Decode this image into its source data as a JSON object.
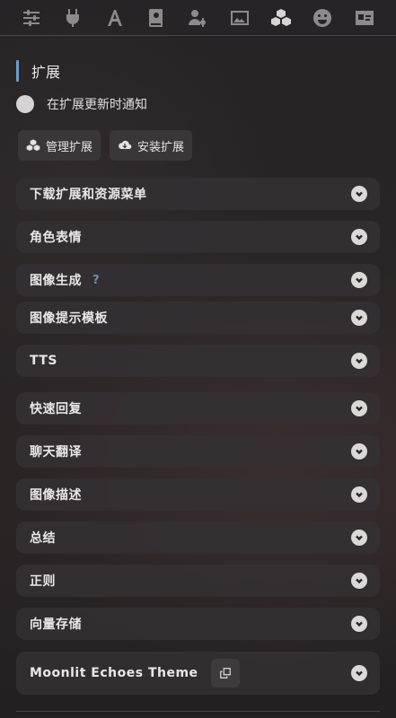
{
  "topbar": {
    "icons": [
      {
        "name": "sliders-icon"
      },
      {
        "name": "plug-icon"
      },
      {
        "name": "font-icon"
      },
      {
        "name": "book-icon"
      },
      {
        "name": "user-gear-icon"
      },
      {
        "name": "image-icon"
      },
      {
        "name": "cubes-icon",
        "active": true
      },
      {
        "name": "smile-icon"
      },
      {
        "name": "id-card-icon"
      }
    ]
  },
  "section": {
    "title": "扩展"
  },
  "notify": {
    "label": "在扩展更新时通知",
    "enabled": false
  },
  "buttons": {
    "manage": "管理扩展",
    "install": "安装扩展"
  },
  "drawers": [
    {
      "label": "下载扩展和资源菜单"
    },
    {
      "label": "角色表情"
    },
    {
      "label": "图像生成",
      "help": "?"
    },
    {
      "label": "图像提示模板"
    },
    {
      "label": "TTS"
    },
    {
      "label": "快速回复"
    },
    {
      "label": "聊天翻译"
    },
    {
      "label": "图像描述"
    },
    {
      "label": "总结"
    },
    {
      "label": "正则"
    },
    {
      "label": "向量存储"
    },
    {
      "label": "Moonlit Echoes Theme"
    }
  ],
  "colors": {
    "accent": "#6b9ccc",
    "drawer_bg": "#343032",
    "text": "#ebe7e7"
  }
}
